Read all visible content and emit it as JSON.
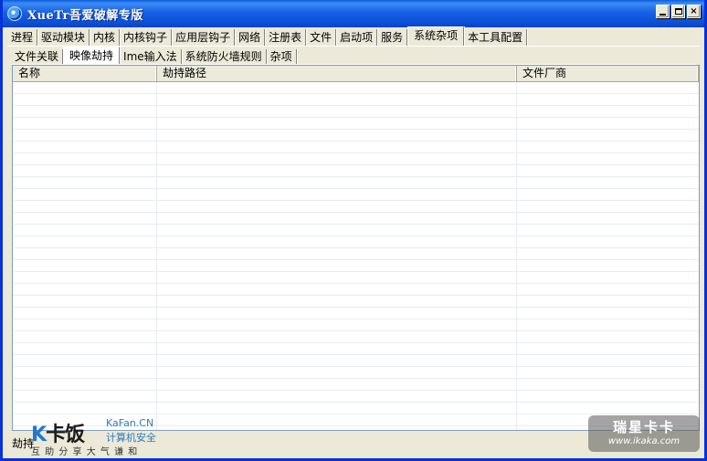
{
  "window": {
    "title": "XueTr吾爱破解专版",
    "controls": {
      "minimize": "minimize",
      "maximize": "maximize",
      "close": "×"
    }
  },
  "main_tabs": [
    {
      "label": "进程",
      "active": false
    },
    {
      "label": "驱动模块",
      "active": false
    },
    {
      "label": "内核",
      "active": false
    },
    {
      "label": "内核钩子",
      "active": false
    },
    {
      "label": "应用层钩子",
      "active": false
    },
    {
      "label": "网络",
      "active": false
    },
    {
      "label": "注册表",
      "active": false
    },
    {
      "label": "文件",
      "active": false
    },
    {
      "label": "启动项",
      "active": false
    },
    {
      "label": "服务",
      "active": false
    },
    {
      "label": "系统杂项",
      "active": true
    },
    {
      "label": "本工具配置",
      "active": false
    }
  ],
  "sub_tabs": [
    {
      "label": "文件关联",
      "active": false
    },
    {
      "label": "映像劫持",
      "active": true
    },
    {
      "label": "Ime输入法",
      "active": false
    },
    {
      "label": "系统防火墙规则",
      "active": false
    },
    {
      "label": "杂项",
      "active": false
    }
  ],
  "list": {
    "columns": [
      "名称",
      "劫持路径",
      "文件厂商"
    ],
    "rows": []
  },
  "status": {
    "text": "劫持"
  },
  "watermarks": {
    "kafan": {
      "logo_k": "K",
      "logo": "卡饭",
      "site": "KaFan.CN",
      "subtitle": "计算机安全",
      "slogan": "互 助 分 享     大 气 谦 和"
    },
    "ikaka": {
      "title": "瑞星卡卡",
      "url": "www.ikaka.com"
    }
  }
}
